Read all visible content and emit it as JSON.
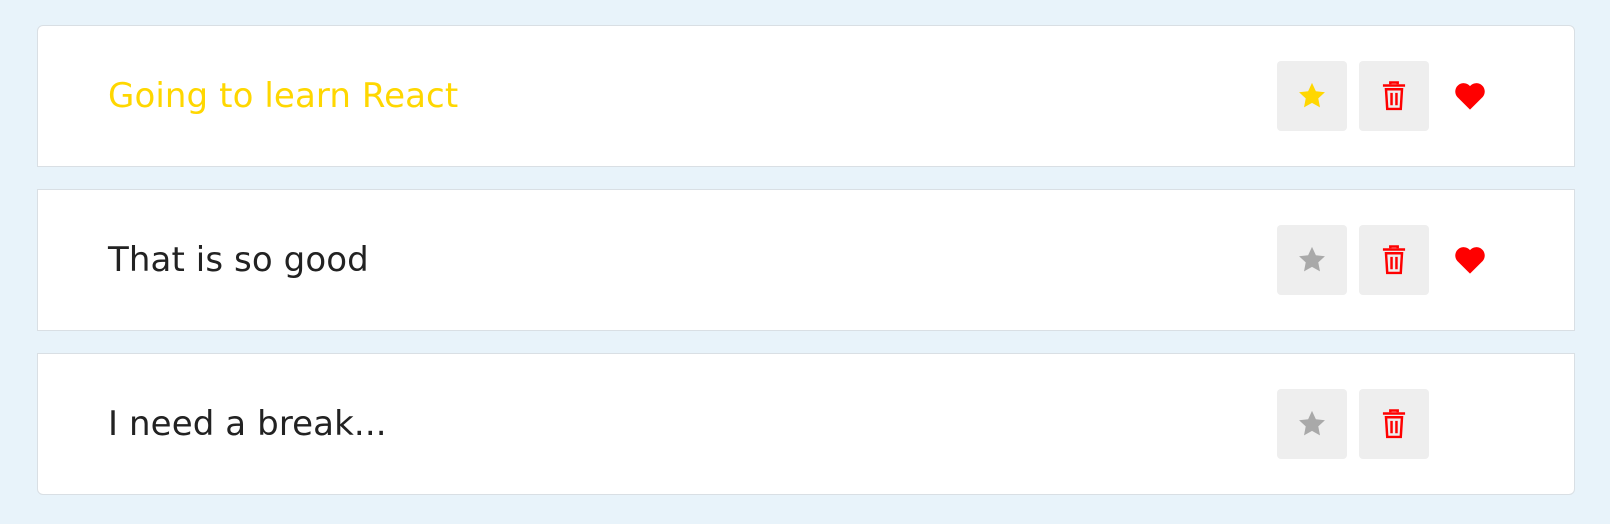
{
  "colors": {
    "background": "#e8f3fa",
    "important_text": "#ffd700",
    "normal_text": "#222222",
    "star_active": "#ffd700",
    "star_inactive": "#a9a9a9",
    "delete": "#ff0000",
    "like": "#ff0000"
  },
  "items": [
    {
      "label": "Going to learn React",
      "important": true,
      "liked": true,
      "star_icon": "star-icon",
      "delete_icon": "trash-icon",
      "like_icon": "heart-icon"
    },
    {
      "label": "That is so good",
      "important": false,
      "liked": true,
      "star_icon": "star-icon",
      "delete_icon": "trash-icon",
      "like_icon": "heart-icon"
    },
    {
      "label": "I need a break...",
      "important": false,
      "liked": false,
      "star_icon": "star-icon",
      "delete_icon": "trash-icon",
      "like_icon": "heart-icon"
    }
  ]
}
